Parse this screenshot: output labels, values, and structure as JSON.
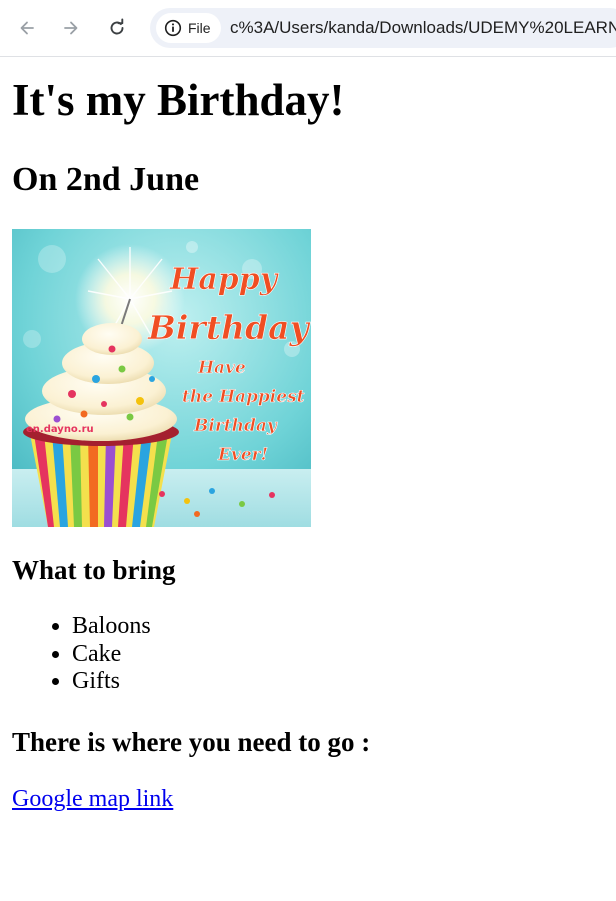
{
  "browser": {
    "file_chip_label": "File",
    "url": "c%3A/Users/kanda/Downloads/UDEMY%20LEARN"
  },
  "page": {
    "heading": "It's my Birthday!",
    "subheading": "On 2nd June",
    "image": {
      "watermark": "en.dayno.ru",
      "lettering": [
        "Happy",
        "Birthday",
        "Have",
        "the Happiest",
        "Birthday",
        "Ever!"
      ]
    },
    "bring_heading": "What to bring",
    "items": [
      "Baloons",
      "Cake",
      "Gifts"
    ],
    "where_heading": "There is where you need to go :",
    "map_link": "Google map link"
  }
}
